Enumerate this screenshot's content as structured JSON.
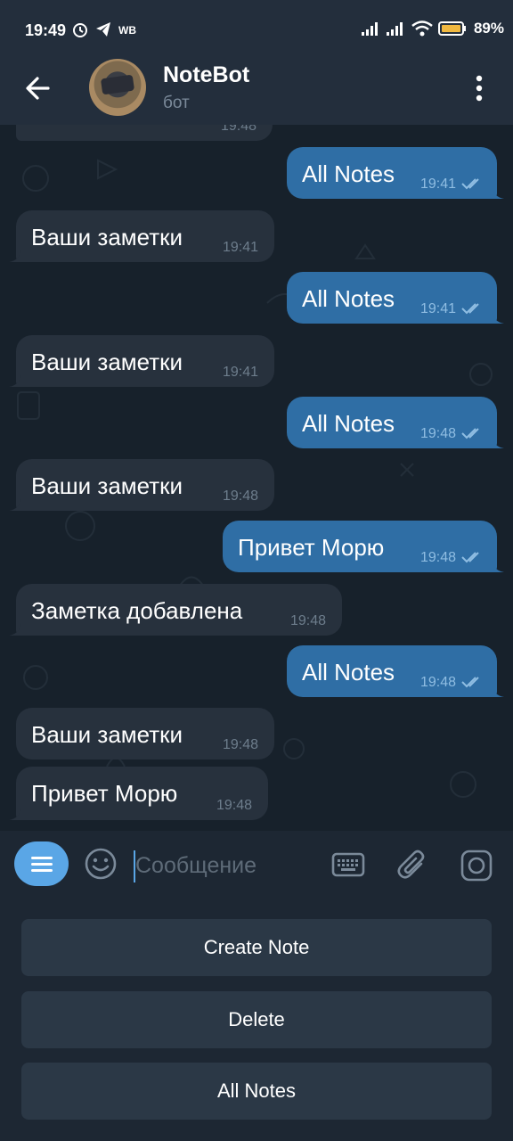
{
  "status_bar": {
    "time": "19:49",
    "carrier_badge": "WB",
    "battery": "89%"
  },
  "header": {
    "title": "NoteBot",
    "subtitle": "бот"
  },
  "messages": [
    {
      "dir": "out",
      "text": "All Notes",
      "time": "19:41"
    },
    {
      "dir": "in",
      "text": "Ваши заметки",
      "time": "19:41"
    },
    {
      "dir": "out",
      "text": "All Notes",
      "time": "19:41"
    },
    {
      "dir": "in",
      "text": "Ваши заметки",
      "time": "19:41"
    },
    {
      "dir": "out",
      "text": "All Notes",
      "time": "19:48"
    },
    {
      "dir": "in",
      "text": "Ваши заметки",
      "time": "19:48"
    },
    {
      "dir": "out",
      "text": "Привет Морю",
      "time": "19:48"
    },
    {
      "dir": "in",
      "text": "Заметка добавлена",
      "time": "19:48"
    },
    {
      "dir": "out",
      "text": "All Notes",
      "time": "19:48"
    },
    {
      "dir": "in",
      "text": "Ваши заметки",
      "time": "19:48"
    },
    {
      "dir": "in",
      "text": "Привет Морю",
      "time": "19:48"
    }
  ],
  "partial_top_time": "19:48",
  "input": {
    "placeholder": "Сообщение"
  },
  "keyboard_buttons": [
    "Create Note",
    "Delete",
    "All Notes"
  ],
  "colors": {
    "accent": "#5aa6e6",
    "bubble_out": "#2f6ea5",
    "bubble_in": "#27313d",
    "header": "#232e3c"
  },
  "icons": [
    "back-arrow-icon",
    "menu-dots-icon",
    "bot-menu-icon",
    "emoji-icon",
    "keyboard-icon",
    "attach-icon",
    "camera-icon"
  ]
}
